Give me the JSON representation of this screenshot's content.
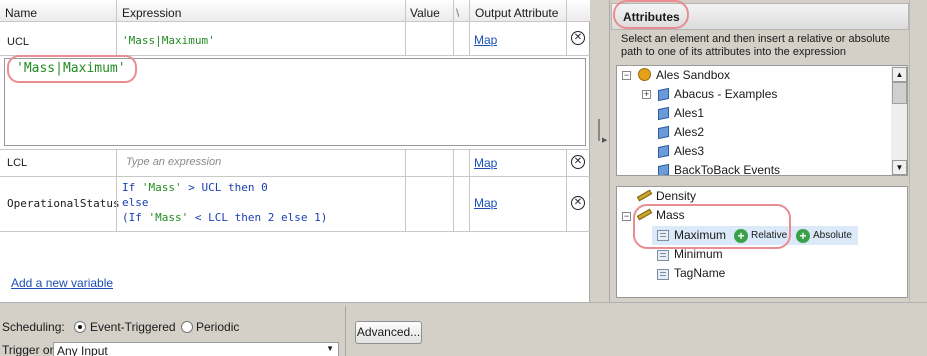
{
  "grid": {
    "headers": {
      "name": "Name",
      "expression": "Expression",
      "value": "Value",
      "extra": "\\",
      "output": "Output Attribute"
    },
    "rows": [
      {
        "name": "UCL",
        "expression": "'Mass|Maximum'",
        "map": "Map"
      },
      {
        "name": "LCL",
        "expression_placeholder": "Type an expression",
        "map": "Map"
      },
      {
        "name": "OperationalStatus",
        "map": "Map",
        "expr_l1_kw": "If ",
        "expr_l1_str": "'Mass'",
        "expr_l1_rest": " > UCL then 0",
        "expr_l2": "else",
        "expr_l3_a": "(If ",
        "expr_l3_str": "'Mass'",
        "expr_l3_b": " < LCL then 2 else 1)"
      }
    ],
    "editor_value": "'Mass|Maximum'",
    "add_variable": "Add a new variable"
  },
  "bottom": {
    "scheduling_label": "Scheduling:",
    "event_triggered": "Event-Triggered",
    "periodic": "Periodic",
    "advanced": "Advanced...",
    "trigger_label": "Trigger on",
    "trigger_value": "Any Input"
  },
  "attributes": {
    "title": "Attributes",
    "hint": "Select an element and then insert a relative or absolute path to one of its attributes into the expression",
    "tree": [
      "Ales Sandbox",
      "Abacus - Examples",
      "Ales1",
      "Ales2",
      "Ales3",
      "BackToBack Events"
    ],
    "attrs": {
      "density": "Density",
      "mass": "Mass",
      "maximum": "Maximum",
      "relative": "Relative",
      "absolute": "Absolute",
      "minimum": "Minimum",
      "tagname": "TagName"
    }
  }
}
